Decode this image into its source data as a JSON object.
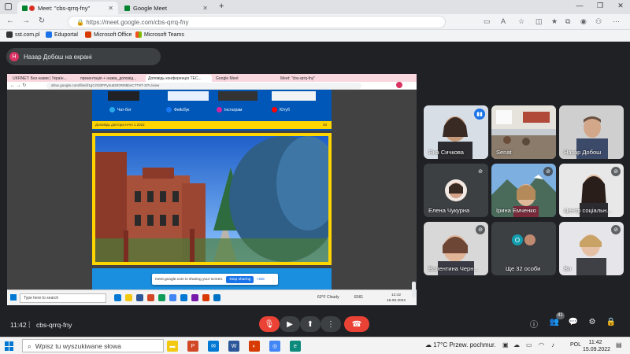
{
  "browser": {
    "tabs": [
      {
        "label": "Meet: \"cbs-qrrq-fny\"",
        "active": true
      },
      {
        "label": "Google Meet",
        "active": false
      }
    ],
    "new_tab": "+",
    "window": {
      "minimize": "—",
      "restore": "❐",
      "close": "✕"
    },
    "url": "https://meet.google.com/cbs-qrrq-fny",
    "bookmarks": [
      "sst.com.pl",
      "Eduportal",
      "Microsoft Office",
      "Microsoft Teams"
    ]
  },
  "meet": {
    "presenter_initial": "Н",
    "presenter_label": "Назар Добош на екрані",
    "time": "11:42",
    "separator": "|",
    "meeting_code": "cbs-qrrq-fny",
    "participants_badge": "41",
    "tiles": [
      {
        "name": "Яна Сичкова",
        "speaking": true
      },
      {
        "name": "Senat",
        "speaking": false
      },
      {
        "name": "Назар Добош",
        "speaking": false
      },
      {
        "name": "Елена Чукурна",
        "speaking": false
      },
      {
        "name": "Ірина Емченко",
        "speaking": false
      },
      {
        "name": "Центр соціальн...",
        "speaking": false
      },
      {
        "name": "Валентина Черн...",
        "speaking": false
      },
      {
        "name": "Ще 32 особи",
        "speaking": false
      },
      {
        "name": "Ви",
        "speaking": false
      }
    ],
    "more_avatar": "O"
  },
  "shared": {
    "tabs": [
      "UKRNET: Без назви | Україн...",
      "презентація + назва_доповід...",
      "Доповідь конференція TEC...",
      "Google Meet",
      "Meet: \"cbs-qrrq-fny\""
    ],
    "url": "drive.google.com/file/d/1gCzt33FPy3u83tOR0t5bnCTT8T-3I7L/view",
    "social": [
      "Чат-бот",
      "Фейсбук",
      "Інстаграм",
      "Ютуб"
    ],
    "footer": "Доповідь доктора НАН 1 2022",
    "page_num": "03",
    "share_notice": "meet.google.com is sharing your screen.",
    "stop_sharing": "Stop sharing",
    "hide": "Hide",
    "search_placeholder": "Type here to search",
    "weather": "63°F Cloudy",
    "lang": "ENG",
    "time": "12:42",
    "date": "15.09.2022"
  },
  "taskbar": {
    "search_placeholder": "Wpisz tu wyszukiwane słowa",
    "weather": "17°C Przew. pochmur.",
    "lang": "POL",
    "time": "11:42",
    "date": "15.09.2022"
  },
  "colors": {
    "accent": "#1a73e8",
    "danger": "#ea4335",
    "meet_bg": "#202124",
    "tile_bg": "#3c4043"
  }
}
